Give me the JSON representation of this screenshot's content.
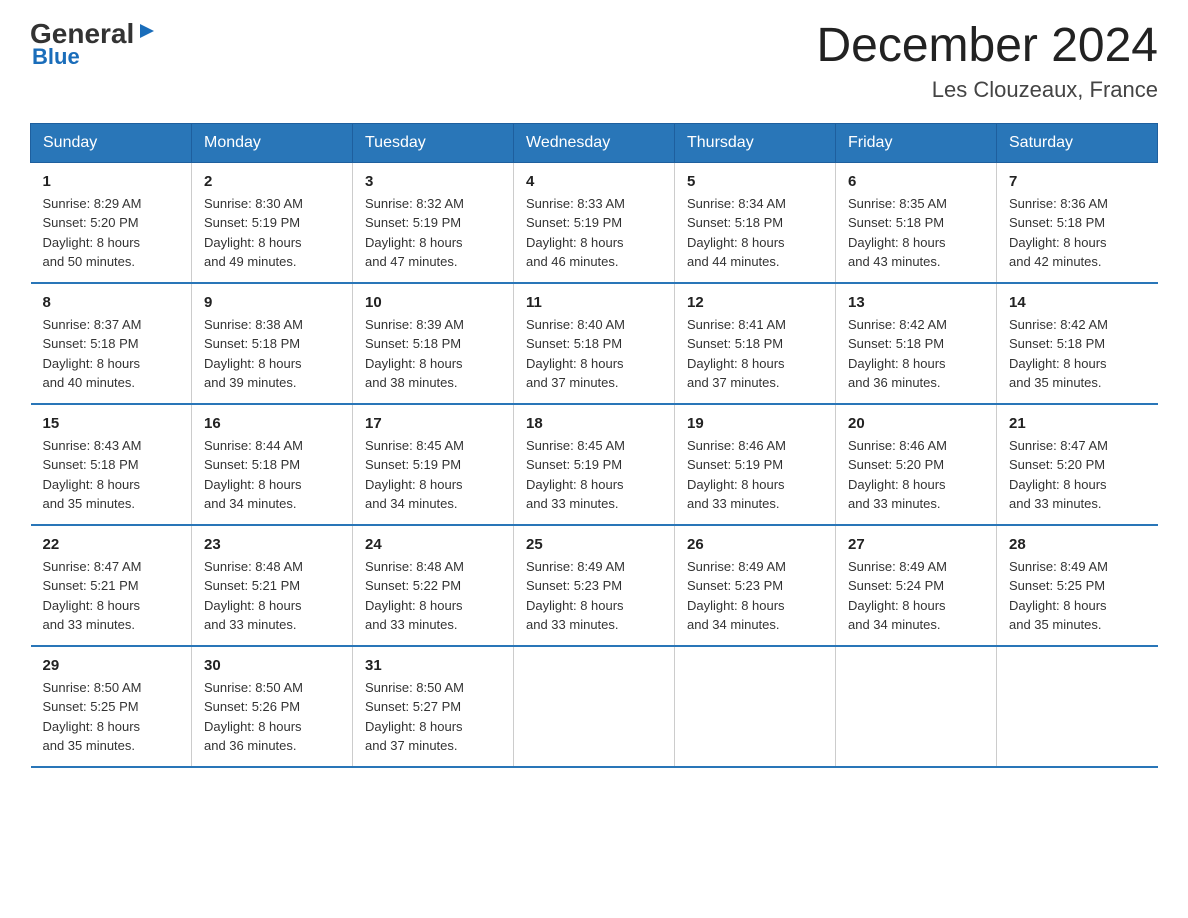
{
  "logo": {
    "general": "General",
    "blue": "Blue",
    "arrow": "▶"
  },
  "title": "December 2024",
  "subtitle": "Les Clouzeaux, France",
  "header_days": [
    "Sunday",
    "Monday",
    "Tuesday",
    "Wednesday",
    "Thursday",
    "Friday",
    "Saturday"
  ],
  "weeks": [
    [
      {
        "day": "1",
        "info": "Sunrise: 8:29 AM\nSunset: 5:20 PM\nDaylight: 8 hours\nand 50 minutes."
      },
      {
        "day": "2",
        "info": "Sunrise: 8:30 AM\nSunset: 5:19 PM\nDaylight: 8 hours\nand 49 minutes."
      },
      {
        "day": "3",
        "info": "Sunrise: 8:32 AM\nSunset: 5:19 PM\nDaylight: 8 hours\nand 47 minutes."
      },
      {
        "day": "4",
        "info": "Sunrise: 8:33 AM\nSunset: 5:19 PM\nDaylight: 8 hours\nand 46 minutes."
      },
      {
        "day": "5",
        "info": "Sunrise: 8:34 AM\nSunset: 5:18 PM\nDaylight: 8 hours\nand 44 minutes."
      },
      {
        "day": "6",
        "info": "Sunrise: 8:35 AM\nSunset: 5:18 PM\nDaylight: 8 hours\nand 43 minutes."
      },
      {
        "day": "7",
        "info": "Sunrise: 8:36 AM\nSunset: 5:18 PM\nDaylight: 8 hours\nand 42 minutes."
      }
    ],
    [
      {
        "day": "8",
        "info": "Sunrise: 8:37 AM\nSunset: 5:18 PM\nDaylight: 8 hours\nand 40 minutes."
      },
      {
        "day": "9",
        "info": "Sunrise: 8:38 AM\nSunset: 5:18 PM\nDaylight: 8 hours\nand 39 minutes."
      },
      {
        "day": "10",
        "info": "Sunrise: 8:39 AM\nSunset: 5:18 PM\nDaylight: 8 hours\nand 38 minutes."
      },
      {
        "day": "11",
        "info": "Sunrise: 8:40 AM\nSunset: 5:18 PM\nDaylight: 8 hours\nand 37 minutes."
      },
      {
        "day": "12",
        "info": "Sunrise: 8:41 AM\nSunset: 5:18 PM\nDaylight: 8 hours\nand 37 minutes."
      },
      {
        "day": "13",
        "info": "Sunrise: 8:42 AM\nSunset: 5:18 PM\nDaylight: 8 hours\nand 36 minutes."
      },
      {
        "day": "14",
        "info": "Sunrise: 8:42 AM\nSunset: 5:18 PM\nDaylight: 8 hours\nand 35 minutes."
      }
    ],
    [
      {
        "day": "15",
        "info": "Sunrise: 8:43 AM\nSunset: 5:18 PM\nDaylight: 8 hours\nand 35 minutes."
      },
      {
        "day": "16",
        "info": "Sunrise: 8:44 AM\nSunset: 5:18 PM\nDaylight: 8 hours\nand 34 minutes."
      },
      {
        "day": "17",
        "info": "Sunrise: 8:45 AM\nSunset: 5:19 PM\nDaylight: 8 hours\nand 34 minutes."
      },
      {
        "day": "18",
        "info": "Sunrise: 8:45 AM\nSunset: 5:19 PM\nDaylight: 8 hours\nand 33 minutes."
      },
      {
        "day": "19",
        "info": "Sunrise: 8:46 AM\nSunset: 5:19 PM\nDaylight: 8 hours\nand 33 minutes."
      },
      {
        "day": "20",
        "info": "Sunrise: 8:46 AM\nSunset: 5:20 PM\nDaylight: 8 hours\nand 33 minutes."
      },
      {
        "day": "21",
        "info": "Sunrise: 8:47 AM\nSunset: 5:20 PM\nDaylight: 8 hours\nand 33 minutes."
      }
    ],
    [
      {
        "day": "22",
        "info": "Sunrise: 8:47 AM\nSunset: 5:21 PM\nDaylight: 8 hours\nand 33 minutes."
      },
      {
        "day": "23",
        "info": "Sunrise: 8:48 AM\nSunset: 5:21 PM\nDaylight: 8 hours\nand 33 minutes."
      },
      {
        "day": "24",
        "info": "Sunrise: 8:48 AM\nSunset: 5:22 PM\nDaylight: 8 hours\nand 33 minutes."
      },
      {
        "day": "25",
        "info": "Sunrise: 8:49 AM\nSunset: 5:23 PM\nDaylight: 8 hours\nand 33 minutes."
      },
      {
        "day": "26",
        "info": "Sunrise: 8:49 AM\nSunset: 5:23 PM\nDaylight: 8 hours\nand 34 minutes."
      },
      {
        "day": "27",
        "info": "Sunrise: 8:49 AM\nSunset: 5:24 PM\nDaylight: 8 hours\nand 34 minutes."
      },
      {
        "day": "28",
        "info": "Sunrise: 8:49 AM\nSunset: 5:25 PM\nDaylight: 8 hours\nand 35 minutes."
      }
    ],
    [
      {
        "day": "29",
        "info": "Sunrise: 8:50 AM\nSunset: 5:25 PM\nDaylight: 8 hours\nand 35 minutes."
      },
      {
        "day": "30",
        "info": "Sunrise: 8:50 AM\nSunset: 5:26 PM\nDaylight: 8 hours\nand 36 minutes."
      },
      {
        "day": "31",
        "info": "Sunrise: 8:50 AM\nSunset: 5:27 PM\nDaylight: 8 hours\nand 37 minutes."
      },
      {
        "day": "",
        "info": ""
      },
      {
        "day": "",
        "info": ""
      },
      {
        "day": "",
        "info": ""
      },
      {
        "day": "",
        "info": ""
      }
    ]
  ]
}
